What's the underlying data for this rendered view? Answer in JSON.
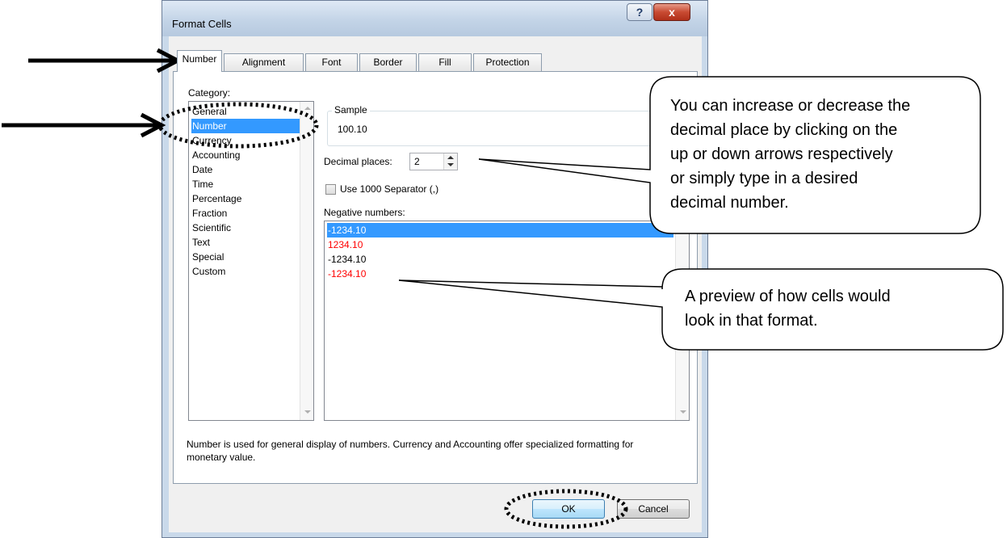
{
  "window": {
    "title": "Format Cells",
    "help_glyph": "?",
    "close_glyph": "x"
  },
  "tabs": [
    {
      "label": "Number",
      "active": true
    },
    {
      "label": "Alignment"
    },
    {
      "label": "Font"
    },
    {
      "label": "Border"
    },
    {
      "label": "Fill"
    },
    {
      "label": "Protection"
    }
  ],
  "category": {
    "label": "Category:",
    "items": [
      "General",
      "Number",
      "Currency",
      "Accounting",
      "Date",
      "Time",
      "Percentage",
      "Fraction",
      "Scientific",
      "Text",
      "Special",
      "Custom"
    ],
    "selected": "Number"
  },
  "sample": {
    "label": "Sample",
    "value": "100.10"
  },
  "decimal_places": {
    "label": "Decimal places:",
    "value": "2"
  },
  "separator": {
    "label": "Use 1000 Separator (,)",
    "checked": false
  },
  "negative_numbers": {
    "label": "Negative numbers:",
    "items": [
      {
        "text": "-1234.10",
        "color": "#ffffff",
        "selected": true
      },
      {
        "text": "1234.10",
        "color": "#ff0000"
      },
      {
        "text": "-1234.10",
        "color": "#000000"
      },
      {
        "text": "-1234.10",
        "color": "#ff0000"
      }
    ]
  },
  "description": "Number is used for general display of numbers.  Currency and Accounting offer specialized formatting for monetary value.",
  "buttons": {
    "ok": "OK",
    "cancel": "Cancel"
  },
  "callouts": {
    "decimal": [
      "You can increase or decrease the",
      "decimal place by clicking on the",
      "up or down arrows respectively",
      "or simply type in a desired",
      "decimal number."
    ],
    "preview": [
      "A preview of how cells would",
      "look in that format."
    ]
  },
  "colors": {
    "selection": "#3399ff",
    "negative_red": "#ff0000"
  }
}
